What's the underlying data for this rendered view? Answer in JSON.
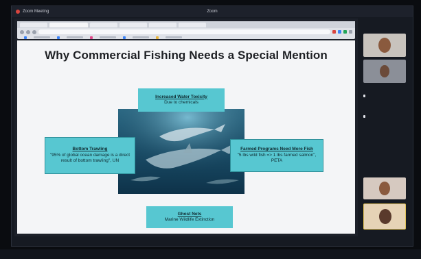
{
  "window": {
    "title_left": "Zoom Meeting",
    "title_center": "Zoom"
  },
  "slide": {
    "title": "Why Commercial Fishing Needs a Special Mention",
    "boxes": {
      "top": {
        "head": "Increased Water Toxicity",
        "body": "Due to chemicals"
      },
      "left": {
        "head": "Bottom Trawling",
        "body": "\"95% of global ocean damage is a direct result of bottom trawling\", UN"
      },
      "right": {
        "head": "Farmed Programs Need More Fish",
        "body": "\"5 lbs wild fish => 1 lbs farmed salmon\", PETA"
      },
      "bottom": {
        "head": "Ghost Nets",
        "body": "Marine Wildlife Extinction"
      }
    }
  },
  "participants": {
    "sections": [
      {
        "big": "",
        "small": ""
      },
      {
        "big": "",
        "small": ""
      }
    ]
  },
  "colors": {
    "accent_box": "#57c7d1",
    "slide_bg": "#f4f5f7",
    "frame_bg": "#0a0c10"
  }
}
